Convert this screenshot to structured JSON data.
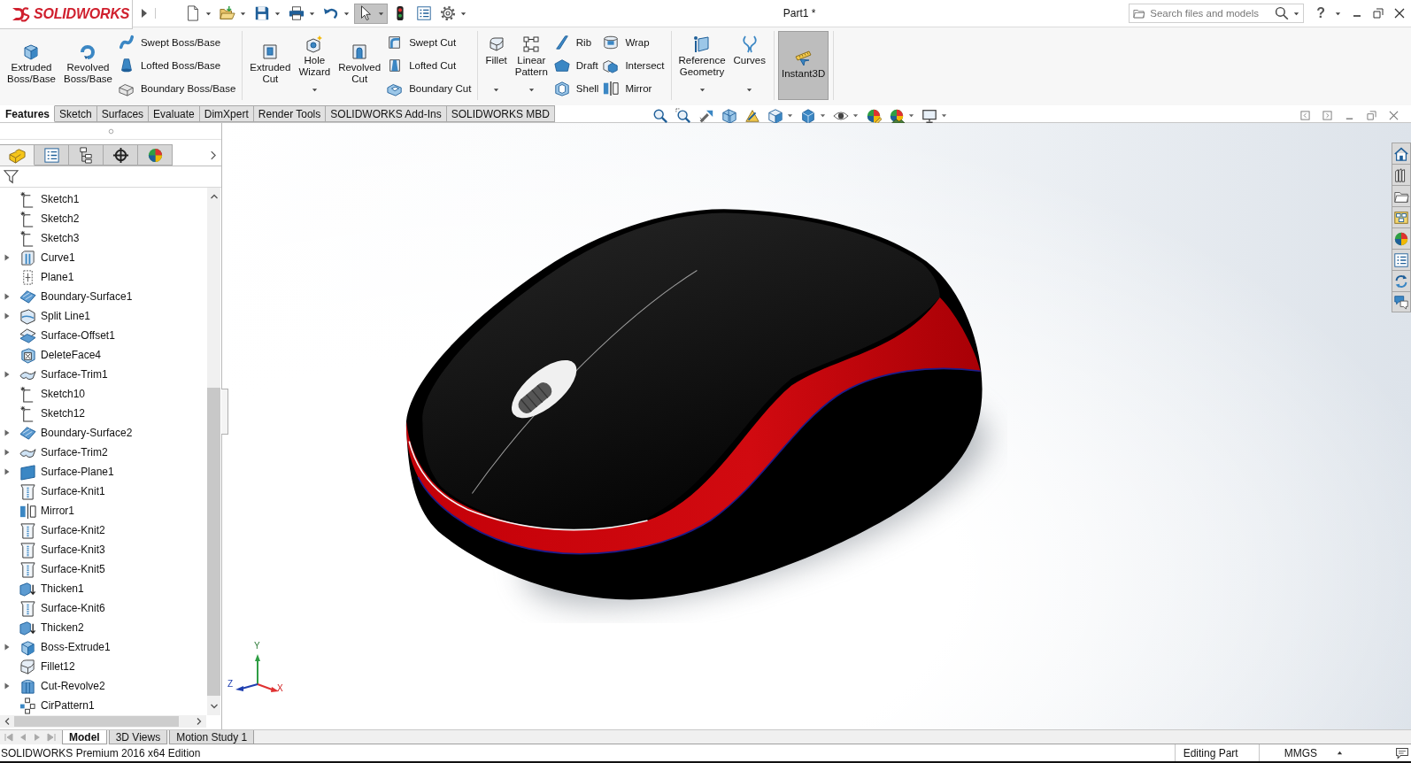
{
  "title_bar": {
    "logo": "SOLIDWORKS",
    "quick_access": [
      {
        "kind": "new",
        "dropdown": true,
        "pressed": false
      },
      {
        "kind": "open",
        "dropdown": true,
        "pressed": false
      },
      {
        "kind": "save",
        "dropdown": true,
        "pressed": false
      },
      {
        "kind": "print",
        "dropdown": true,
        "pressed": false
      },
      {
        "kind": "undo",
        "dropdown": true,
        "pressed": false
      },
      {
        "kind": "select",
        "dropdown": true,
        "pressed": true
      },
      {
        "kind": "rebuild",
        "dropdown": false,
        "pressed": false
      },
      {
        "kind": "properties",
        "dropdown": false,
        "pressed": false
      },
      {
        "kind": "options",
        "dropdown": true,
        "pressed": false
      }
    ],
    "document_title": "Part1 *",
    "search": {
      "placeholder": "Search files and models"
    },
    "help": "?"
  },
  "ribbon": {
    "groups": [
      {
        "columns": [
          {
            "kind": "large",
            "label": "Extruded Boss/Base",
            "dropdown": false,
            "pressed": false
          },
          {
            "kind": "large",
            "label": "Revolved Boss/Base",
            "dropdown": false,
            "pressed": false
          },
          {
            "kind": "stack",
            "buttons": [
              {
                "label": "Swept Boss/Base"
              },
              {
                "label": "Lofted Boss/Base"
              },
              {
                "label": "Boundary Boss/Base"
              }
            ]
          }
        ]
      },
      {
        "columns": [
          {
            "kind": "large",
            "label": "Extruded Cut",
            "dropdown": false,
            "pressed": false
          },
          {
            "kind": "large",
            "label": "Hole Wizard",
            "dropdown": true,
            "pressed": false
          },
          {
            "kind": "large",
            "label": "Revolved Cut",
            "dropdown": false,
            "pressed": false
          },
          {
            "kind": "stack",
            "buttons": [
              {
                "label": "Swept Cut"
              },
              {
                "label": "Lofted Cut"
              },
              {
                "label": "Boundary Cut"
              }
            ]
          }
        ]
      },
      {
        "columns": [
          {
            "kind": "large",
            "label": "Fillet",
            "dropdown": true,
            "pressed": false
          },
          {
            "kind": "large",
            "label": "Linear Pattern",
            "dropdown": true,
            "pressed": false
          },
          {
            "kind": "stack",
            "buttons": [
              {
                "label": "Rib"
              },
              {
                "label": "Draft"
              },
              {
                "label": "Shell"
              }
            ]
          },
          {
            "kind": "stack",
            "buttons": [
              {
                "label": "Wrap"
              },
              {
                "label": "Intersect"
              },
              {
                "label": "Mirror"
              }
            ]
          }
        ]
      },
      {
        "columns": [
          {
            "kind": "large",
            "label": "Reference Geometry",
            "dropdown": true,
            "pressed": false
          },
          {
            "kind": "large",
            "label": "Curves",
            "dropdown": true,
            "pressed": false
          }
        ]
      },
      {
        "columns": [
          {
            "kind": "large",
            "label": "Instant3D",
            "dropdown": false,
            "pressed": true
          }
        ]
      }
    ]
  },
  "command_tabs": [
    {
      "label": "Features",
      "selected": true
    },
    {
      "label": "Sketch",
      "selected": false
    },
    {
      "label": "Surfaces",
      "selected": false
    },
    {
      "label": "Evaluate",
      "selected": false
    },
    {
      "label": "DimXpert",
      "selected": false
    },
    {
      "label": "Render Tools",
      "selected": false
    },
    {
      "label": "SOLIDWORKS Add-Ins",
      "selected": false
    },
    {
      "label": "SOLIDWORKS MBD",
      "selected": false
    }
  ],
  "feature_manager": {
    "tabs": [
      {
        "kind": "features",
        "selected": true
      },
      {
        "kind": "properties",
        "selected": false
      },
      {
        "kind": "configurations",
        "selected": false
      },
      {
        "kind": "dimxpert",
        "selected": false
      },
      {
        "kind": "display",
        "selected": false
      }
    ],
    "tree": [
      {
        "label": "Sketch1",
        "kind": "sketch",
        "expandable": false
      },
      {
        "label": "Sketch2",
        "kind": "sketch",
        "expandable": false
      },
      {
        "label": "Sketch3",
        "kind": "sketch",
        "expandable": false
      },
      {
        "label": "Curve1",
        "kind": "curve",
        "expandable": true
      },
      {
        "label": "Plane1",
        "kind": "plane",
        "expandable": false
      },
      {
        "label": "Boundary-Surface1",
        "kind": "boundary-surface",
        "expandable": true
      },
      {
        "label": "Split Line1",
        "kind": "split-line",
        "expandable": true
      },
      {
        "label": "Surface-Offset1",
        "kind": "offset-surface",
        "expandable": false
      },
      {
        "label": "DeleteFace4",
        "kind": "delete-face",
        "expandable": false
      },
      {
        "label": "Surface-Trim1",
        "kind": "trim-surface",
        "expandable": true
      },
      {
        "label": "Sketch10",
        "kind": "sketch",
        "expandable": false
      },
      {
        "label": "Sketch12",
        "kind": "sketch",
        "expandable": false
      },
      {
        "label": "Boundary-Surface2",
        "kind": "boundary-surface",
        "expandable": true
      },
      {
        "label": "Surface-Trim2",
        "kind": "trim-surface",
        "expandable": true
      },
      {
        "label": "Surface-Plane1",
        "kind": "planar-surface",
        "expandable": true
      },
      {
        "label": "Surface-Knit1",
        "kind": "knit",
        "expandable": false
      },
      {
        "label": "Mirror1",
        "kind": "mirror",
        "expandable": false
      },
      {
        "label": "Surface-Knit2",
        "kind": "knit",
        "expandable": false
      },
      {
        "label": "Surface-Knit3",
        "kind": "knit",
        "expandable": false
      },
      {
        "label": "Surface-Knit5",
        "kind": "knit",
        "expandable": false
      },
      {
        "label": "Thicken1",
        "kind": "thicken",
        "expandable": false
      },
      {
        "label": "Surface-Knit6",
        "kind": "knit",
        "expandable": false
      },
      {
        "label": "Thicken2",
        "kind": "thicken",
        "expandable": false
      },
      {
        "label": "Boss-Extrude1",
        "kind": "extrude",
        "expandable": true
      },
      {
        "label": "Fillet12",
        "kind": "fillet",
        "expandable": false
      },
      {
        "label": "Cut-Revolve2",
        "kind": "revolve",
        "expandable": true
      },
      {
        "label": "CirPattern1",
        "kind": "pattern",
        "expandable": false
      }
    ]
  },
  "triad": {
    "labels": [
      "Y",
      "Z",
      "X"
    ]
  },
  "bottom_tabs": [
    {
      "label": "Model",
      "selected": true
    },
    {
      "label": "3D Views",
      "selected": false
    },
    {
      "label": "Motion Study 1",
      "selected": false
    }
  ],
  "status_bar": {
    "edition": "SOLIDWORKS Premium 2016 x64 Edition",
    "mode": "Editing Part",
    "units": "MMGS"
  }
}
